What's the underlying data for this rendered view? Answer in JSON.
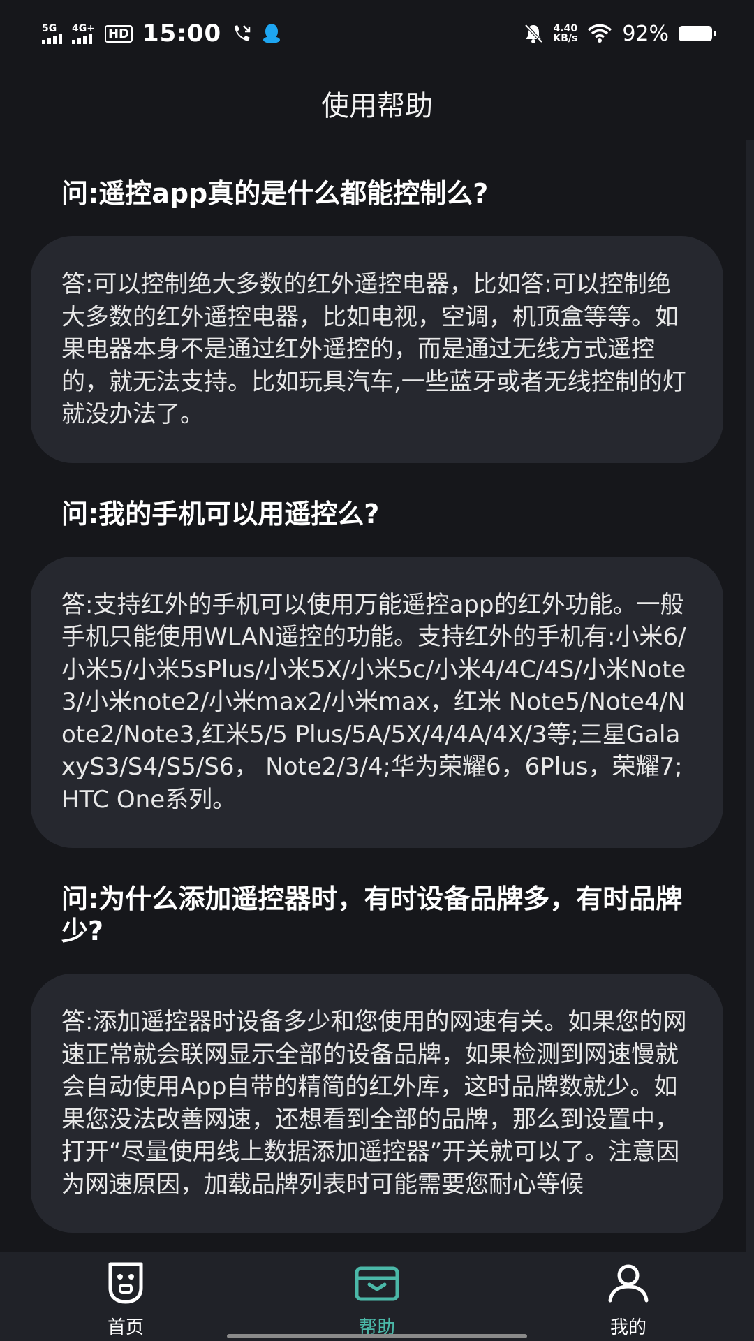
{
  "status": {
    "sim1": "5G",
    "sim2": "4G+",
    "hd": "HD",
    "time": "15:00",
    "speed_value": "4.40",
    "speed_unit": "KB/s",
    "battery": "92%"
  },
  "header": {
    "title": "使用帮助"
  },
  "faq": [
    {
      "question": "问:遥控app真的是什么都能控制么?",
      "answer": "答:可以控制绝大多数的红外遥控电器，比如答:可以控制绝大多数的红外遥控电器，比如电视，空调，机顶盒等等。如果电器本身不是通过红外遥控的，而是通过无线方式遥控的，就无法支持。比如玩具汽车,一些蓝牙或者无线控制的灯就没办法了。"
    },
    {
      "question": "问:我的手机可以用遥控么?",
      "answer": "答:支持红外的手机可以使用万能遥控app的红外功能。一般手机只能使用WLAN遥控的功能。支持红外的手机有:小米6/小米5/小米5sPlus/小米5X/小米5c/小米4/4C/4S/小米Note3/小米note2/小米max2/小米max，红米 Note5/Note4/Note2/Note3,红米5/5  Plus/5A/5X/4/4A/4X/3等;三星GalaxyS3/S4/S5/S6， Note2/3/4;华为荣耀6，6Plus，荣耀7;HTC One系列。"
    },
    {
      "question": "问:为什么添加遥控器时，有时设备品牌多，有时品牌少?",
      "answer": "答:添加遥控器时设备多少和您使用的网速有关。如果您的网速正常就会联网显示全部的设备品牌，如果检测到网速慢就会自动使用App自带的精简的红外库，这时品牌数就少。如果您没法改善网速，还想看到全部的品牌，那么到设置中，打开“尽量使用线上数据添加遥控器”开关就可以了。注意因为网速原因，加载品牌列表时可能需要您耐心等候"
    }
  ],
  "tabs": [
    {
      "label": "首页",
      "icon": "remote-face-icon",
      "active": false
    },
    {
      "label": "帮助",
      "icon": "wallet-icon",
      "active": true
    },
    {
      "label": "我的",
      "icon": "person-icon",
      "active": false
    }
  ],
  "colors": {
    "background": "#16171b",
    "card": "#26282f",
    "accent": "#4bb8a8",
    "tabbar": "#202228"
  }
}
